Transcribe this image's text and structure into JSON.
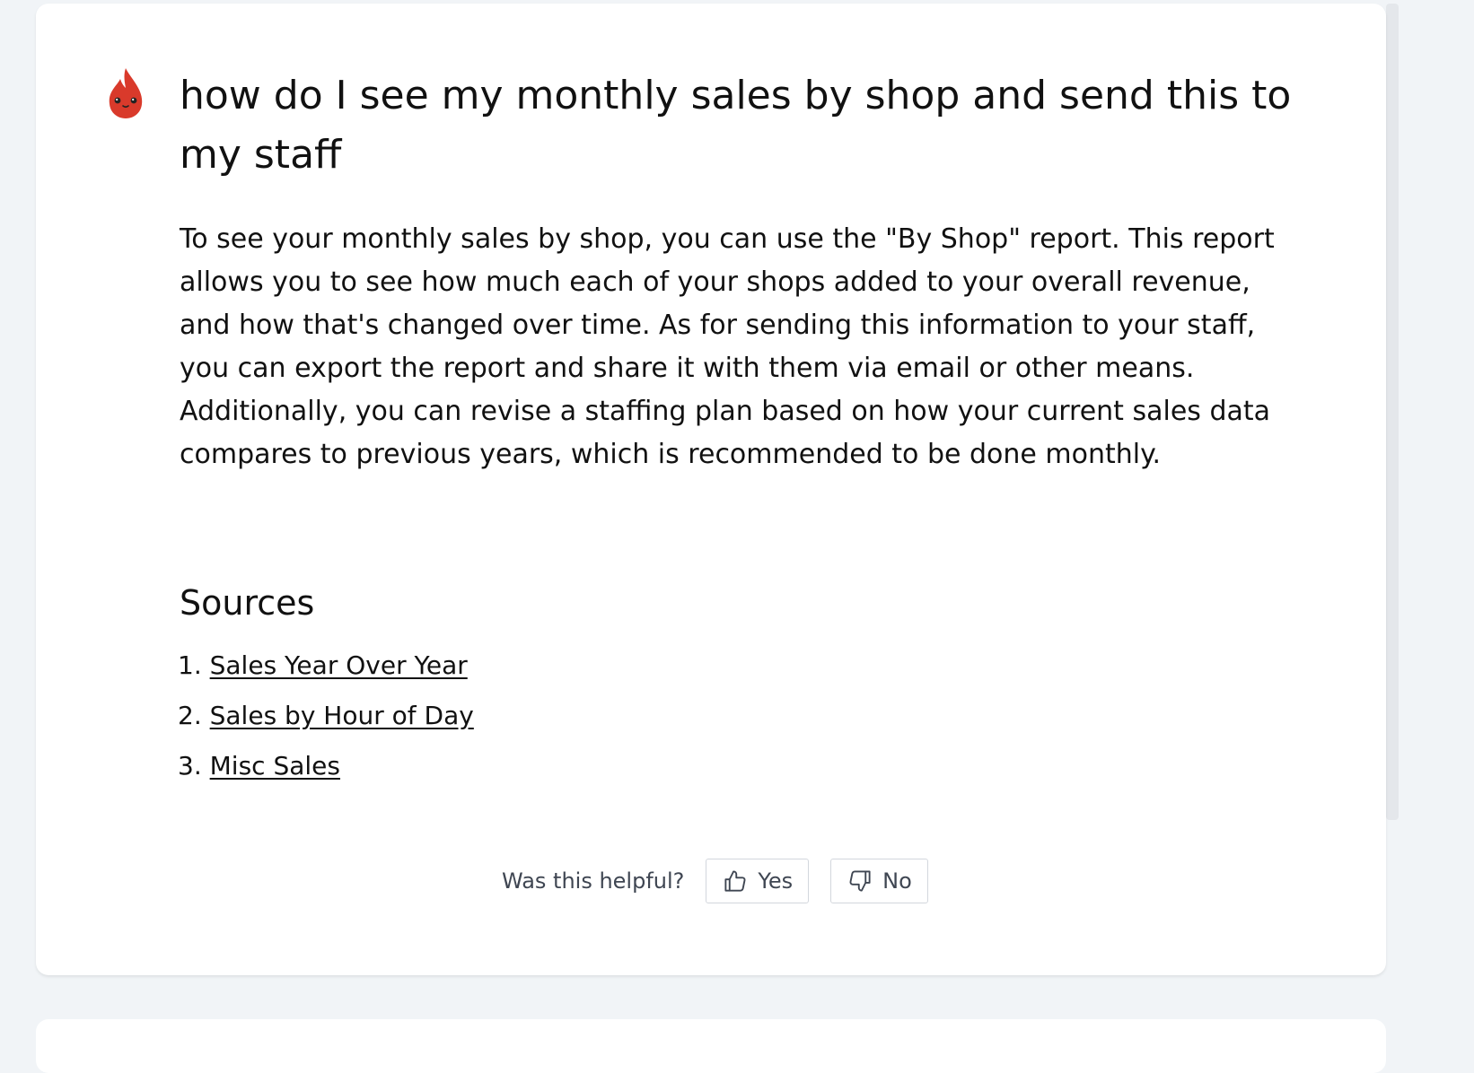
{
  "question": "how do I see my monthly sales by shop and send this to my staff",
  "answer": "To see your monthly sales by shop, you can use the \"By Shop\" report. This report allows you to see how much each of your shops added to your overall revenue, and how that's changed over time. As for sending this information to your staff, you can export the report and share it with them via email or other means. Additionally, you can revise a staffing plan based on how your current sales data compares to previous years, which is recommended to be done monthly.",
  "sources": {
    "heading": "Sources",
    "items": [
      {
        "number": "1.",
        "label": "Sales Year Over Year"
      },
      {
        "number": "2.",
        "label": "Sales by Hour of Day"
      },
      {
        "number": "3.",
        "label": "Misc Sales"
      }
    ]
  },
  "feedback": {
    "prompt": "Was this helpful?",
    "yes_label": "Yes",
    "no_label": "No",
    "yes_icon": "thumbs-up-icon",
    "no_icon": "thumbs-down-icon"
  },
  "colors": {
    "background": "#f1f4f7",
    "card": "#ffffff",
    "logo_red": "#d93a2b",
    "text_muted": "#3f4652"
  }
}
